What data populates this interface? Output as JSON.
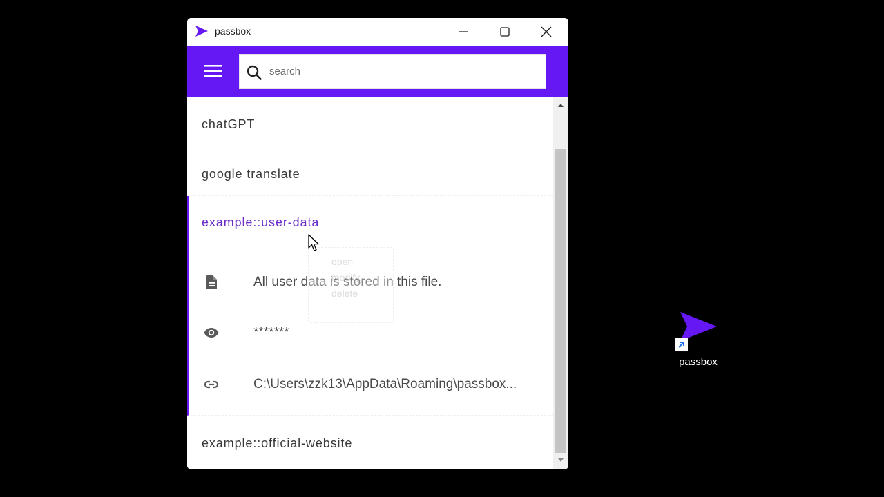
{
  "window": {
    "title": "passbox"
  },
  "colors": {
    "accent": "#6518f4",
    "active_text": "#6a2cc9"
  },
  "search": {
    "placeholder": "search",
    "value": ""
  },
  "items": [
    {
      "title": "chatGPT"
    },
    {
      "title": "google translate"
    },
    {
      "title": "example::user-data",
      "expanded": true,
      "details": {
        "description": "All user data is stored in this file.",
        "password": "*******",
        "link": "C:\\Users\\zzk13\\AppData\\Roaming\\passbox..."
      }
    },
    {
      "title": "example::official-website"
    }
  ],
  "context_menu": {
    "items": [
      "open",
      "modify",
      "delete"
    ]
  },
  "icons": {
    "menu": "hamburger-icon",
    "search": "search-icon",
    "description": "document-icon",
    "password": "eye-icon",
    "link": "link-icon",
    "minimize": "minimize-icon",
    "maximize": "maximize-icon",
    "close": "close-icon"
  },
  "desktop": {
    "shortcut_label": "passbox"
  }
}
